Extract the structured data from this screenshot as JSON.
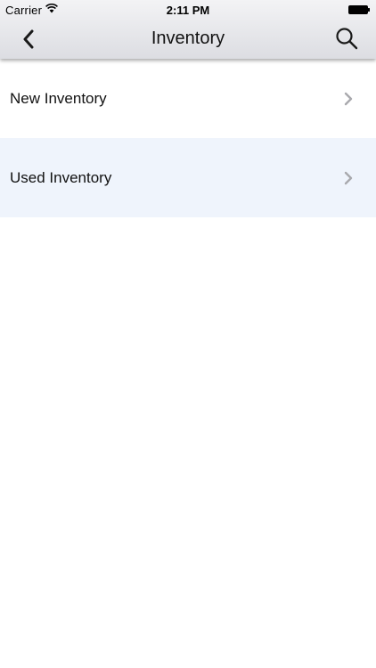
{
  "status_bar": {
    "carrier": "Carrier",
    "time": "2:11 PM"
  },
  "nav": {
    "title": "Inventory",
    "back_icon": "chevron-left-icon",
    "search_icon": "search-icon"
  },
  "list": {
    "items": [
      {
        "label": "New Inventory",
        "icon": "chevron-right-icon"
      },
      {
        "label": "Used Inventory",
        "icon": "chevron-right-icon"
      }
    ]
  },
  "colors": {
    "header_top": "#f3f3f5",
    "header_bottom": "#dcdde2",
    "alt_row": "#eff4fc",
    "chevron": "#a9a9ad"
  }
}
